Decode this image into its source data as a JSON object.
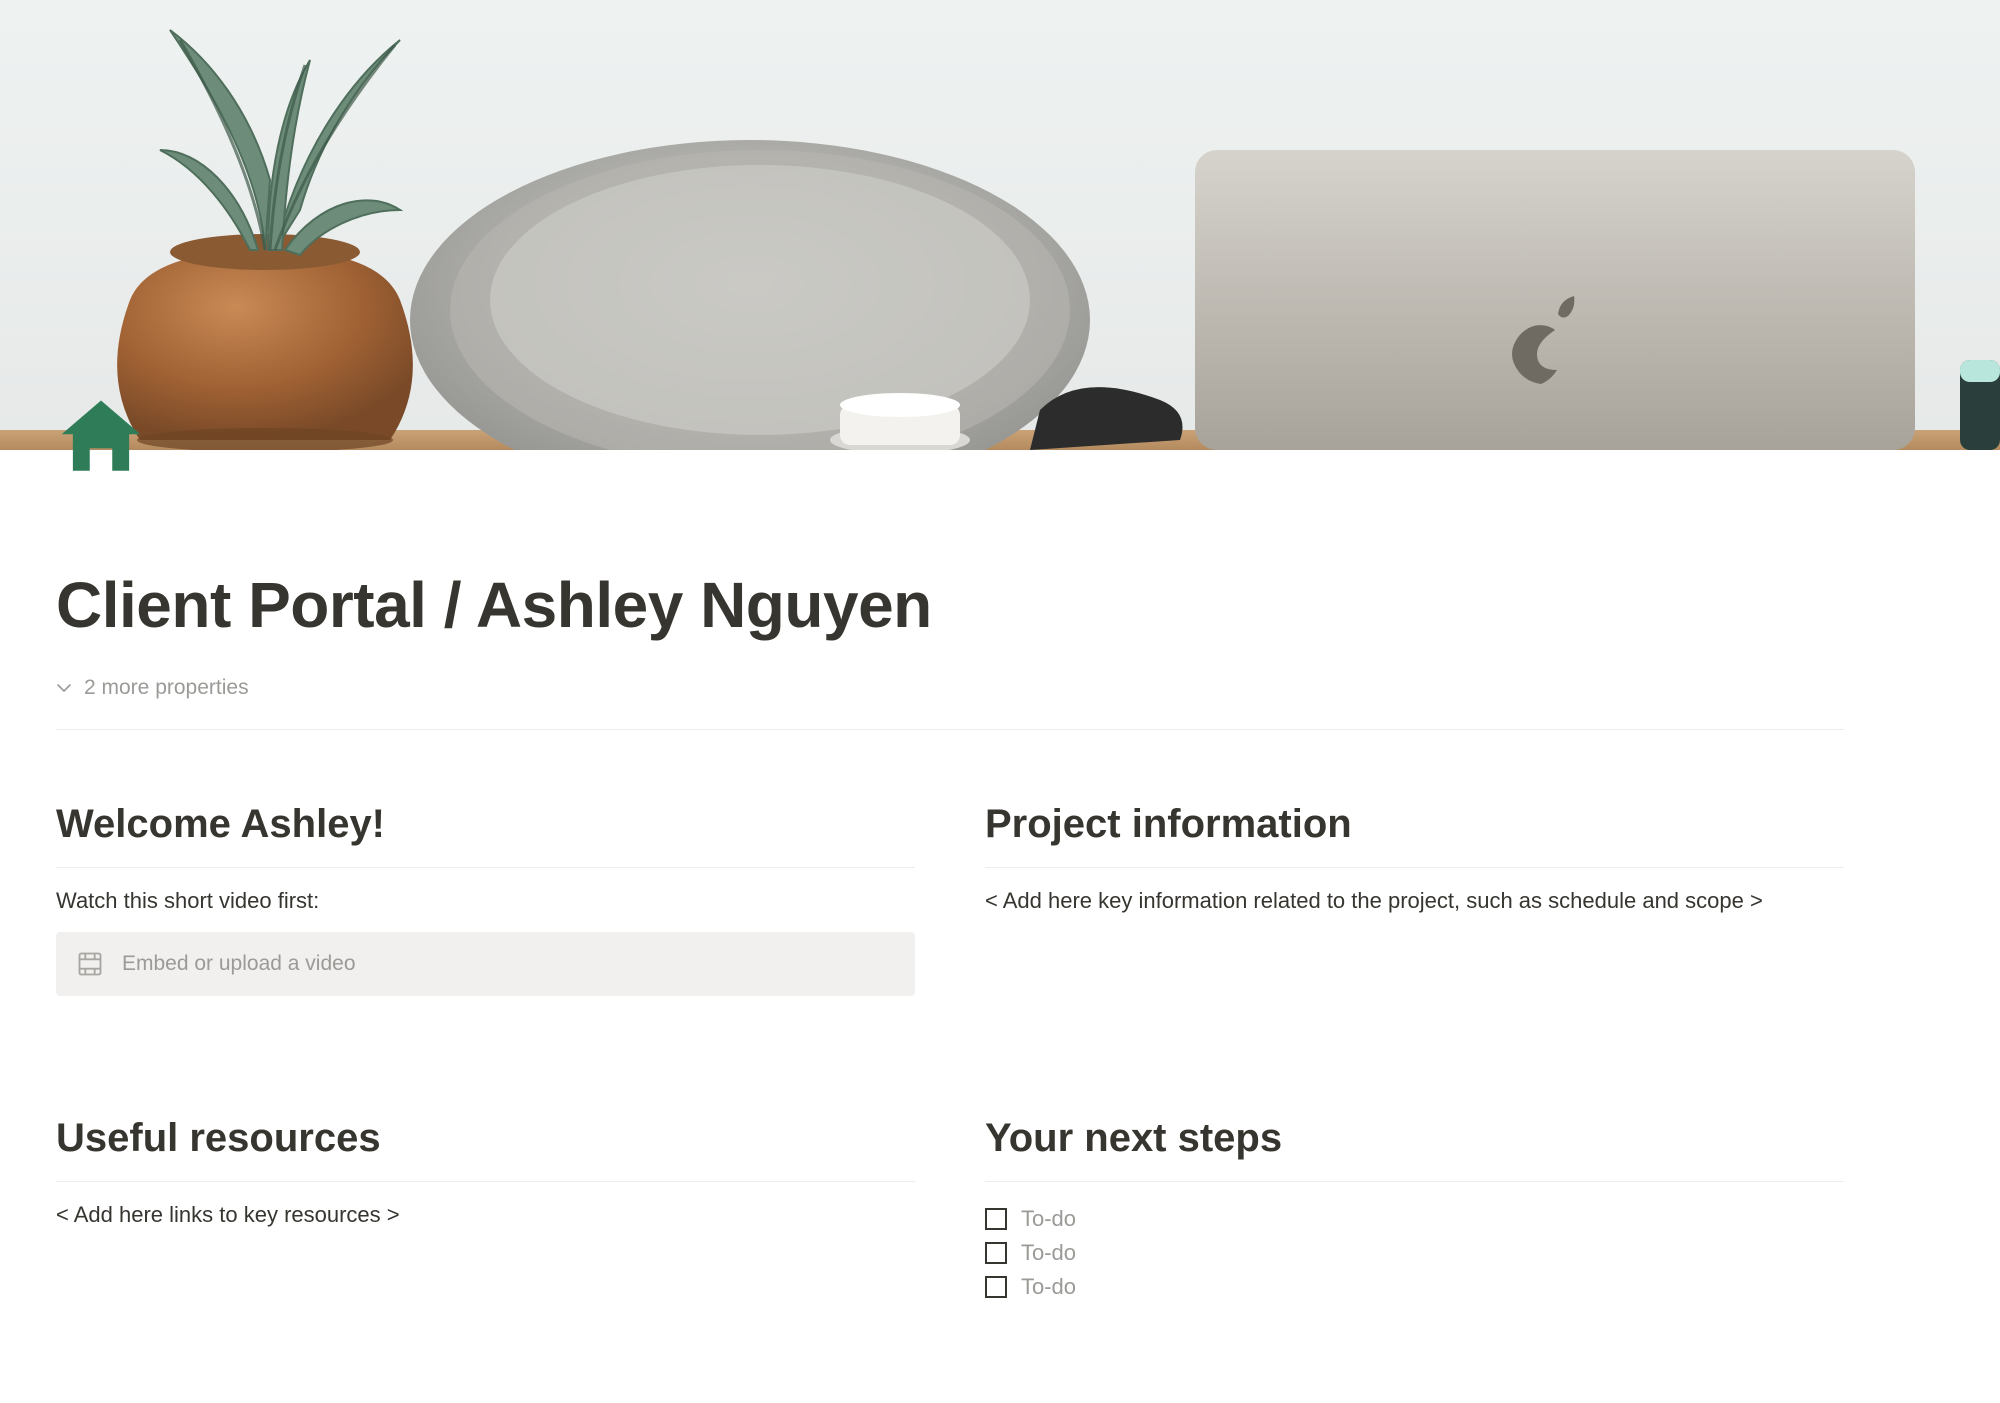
{
  "title": "Client Portal / Ashley Nguyen",
  "properties": {
    "more_label": "2 more properties"
  },
  "icon": {
    "name": "house-icon",
    "color": "#2f7d58"
  },
  "left_top": {
    "heading": "Welcome Ashley!",
    "intro": "Watch this short video first:",
    "video_placeholder": "Embed or upload a video"
  },
  "right_top": {
    "heading": "Project information",
    "body": "< Add here key information related to the project, such as schedule and scope >"
  },
  "left_bottom": {
    "heading": "Useful resources",
    "body": "< Add here links to key resources >"
  },
  "right_bottom": {
    "heading": "Your next steps",
    "todos": [
      "To-do",
      "To-do",
      "To-do"
    ]
  }
}
